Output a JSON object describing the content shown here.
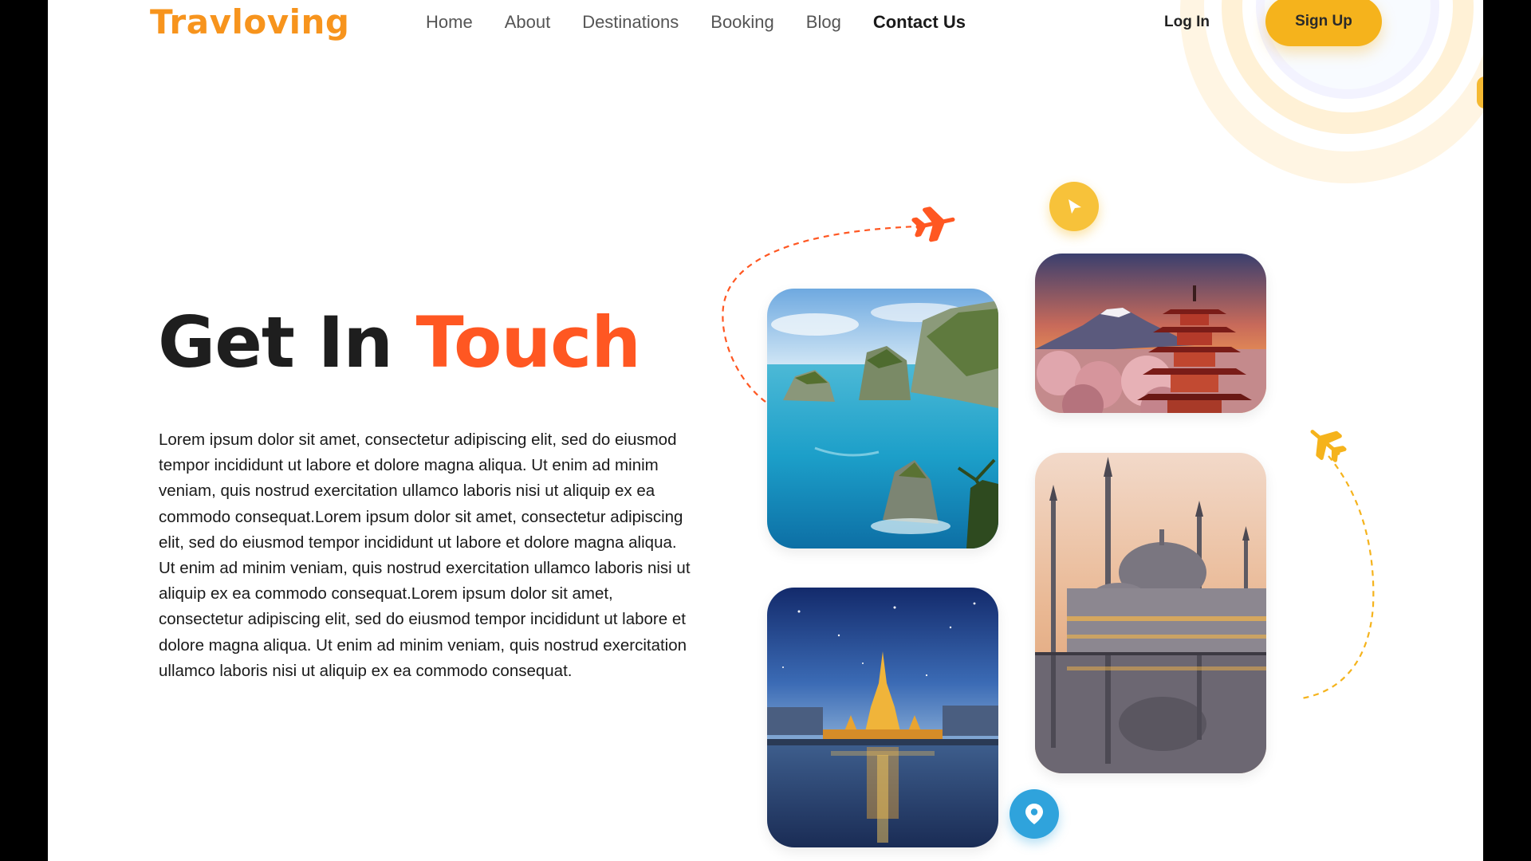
{
  "brand": {
    "logo": "Travloving"
  },
  "nav": {
    "items": [
      {
        "label": "Home"
      },
      {
        "label": "About"
      },
      {
        "label": "Destinations"
      },
      {
        "label": "Booking"
      },
      {
        "label": "Blog"
      },
      {
        "label": "Contact Us",
        "active": true
      }
    ]
  },
  "auth": {
    "login_label": "Log In",
    "signup_label": "Sign Up"
  },
  "hero": {
    "title_part1": "Get In ",
    "title_part2": "Touch",
    "body": "Lorem ipsum dolor sit amet, consectetur adipiscing elit, sed do eiusmod tempor incididunt ut labore et dolore magna aliqua. Ut enim ad minim veniam, quis nostrud exercitation ullamco laboris nisi ut aliquip ex ea commodo consequat.Lorem ipsum dolor sit amet, consectetur adipiscing elit, sed do eiusmod tempor incididunt ut labore et dolore magna aliqua. Ut enim ad minim veniam, quis nostrud exercitation ullamco laboris nisi ut aliquip ex ea commodo consequat.Lorem ipsum dolor sit amet, consectetur adipiscing elit, sed do eiusmod tempor incididunt ut labore et dolore magna aliqua. Ut enim ad minim veniam, quis nostrud exercitation ullamco laboris nisi ut aliquip ex ea commodo consequat."
  },
  "gallery": {
    "images": [
      "island-coast-photo",
      "pagoda-mountain-photo",
      "temple-river-night-photo",
      "mosque-reflection-photo"
    ]
  },
  "icons": {
    "airplane_1": "airplane-icon",
    "airplane_2": "airplane-icon",
    "navigation": "navigation-arrow-icon",
    "location": "location-pin-icon"
  },
  "colors": {
    "brand_orange": "#f7941d",
    "accent": "#ff5722",
    "yellow": "#f5b31c",
    "blue": "#2fa3dc",
    "text": "#1e1e1e"
  }
}
